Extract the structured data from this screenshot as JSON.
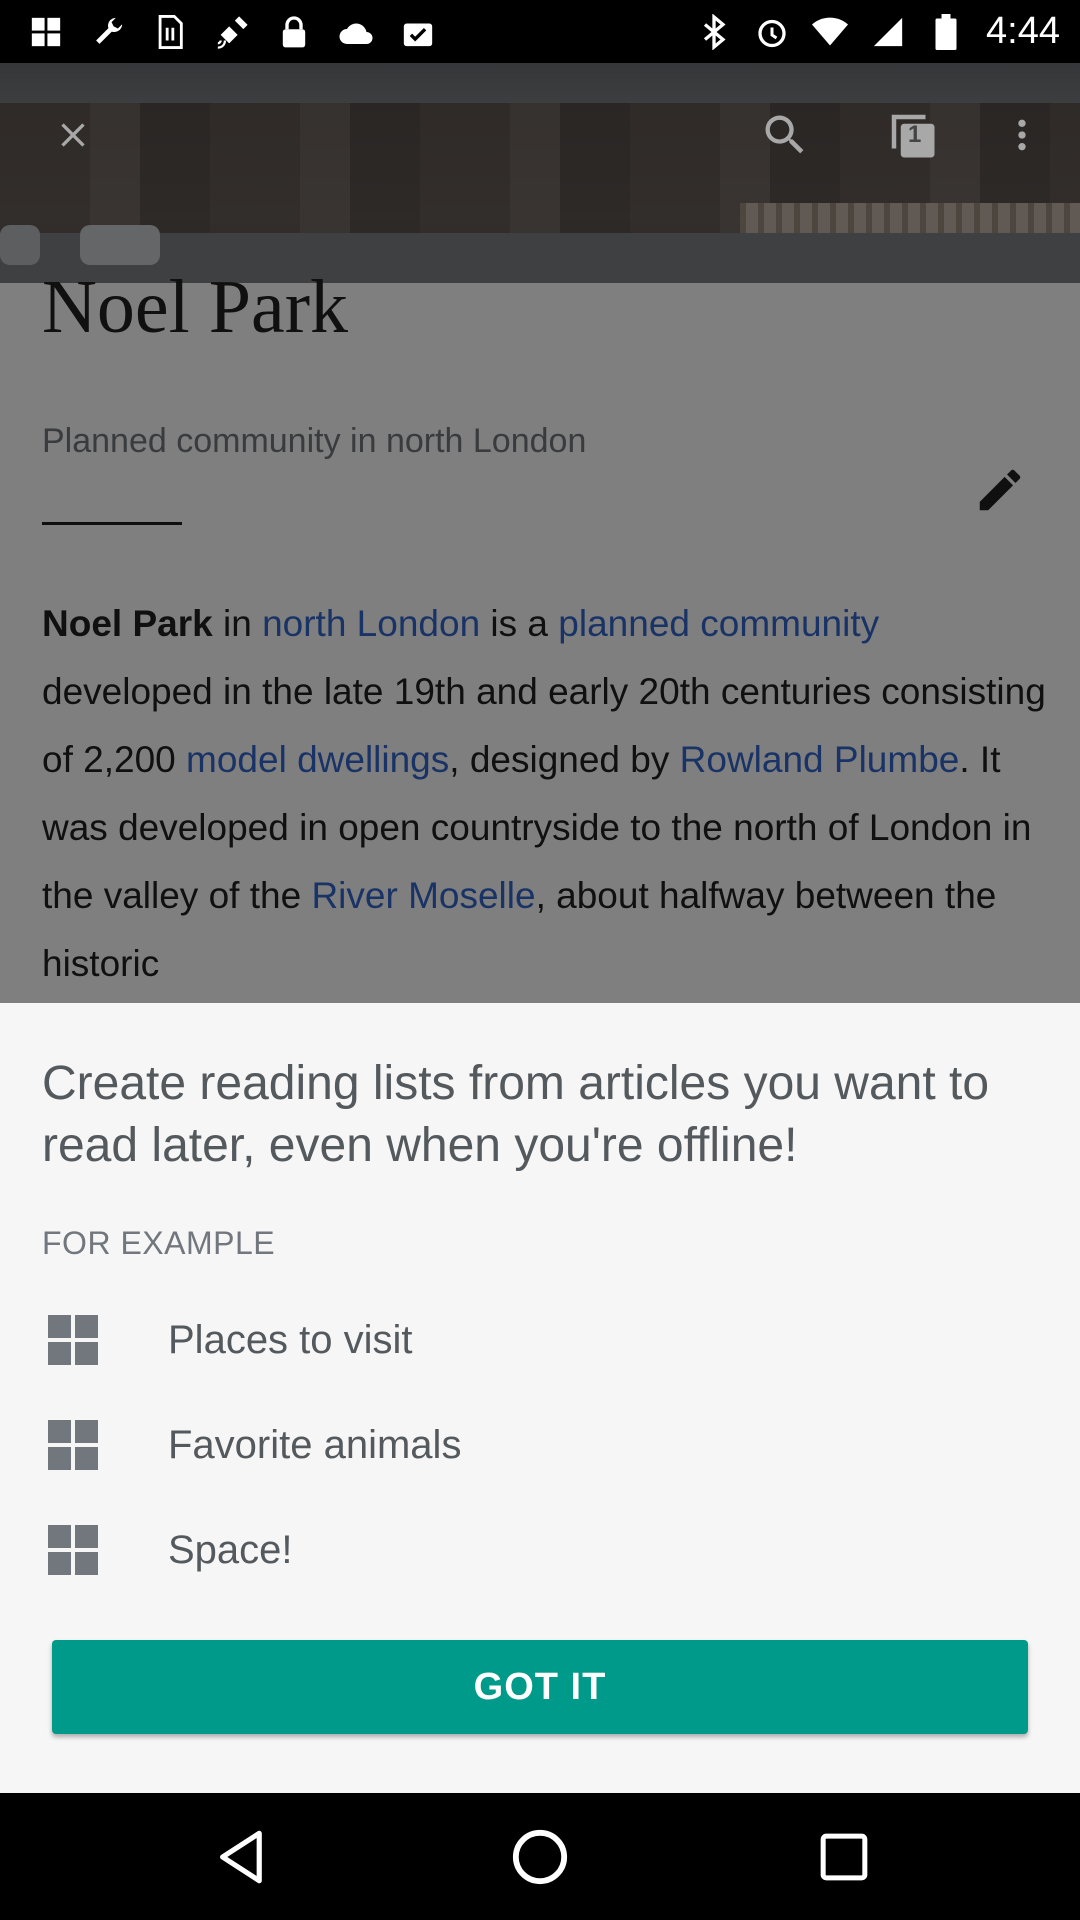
{
  "status_bar": {
    "time": "4:44",
    "left_icons": [
      "grid-icon",
      "wrench-icon",
      "sim-icon",
      "satellite-icon",
      "lock-icon",
      "cloud-icon",
      "checklist-icon"
    ],
    "right_icons": [
      "bluetooth-icon",
      "alarm-icon",
      "wifi-icon",
      "signal-icon",
      "battery-icon"
    ]
  },
  "toolbar": {
    "tabs_count": "1"
  },
  "article": {
    "title": "Noel Park",
    "description": "Planned community in north London",
    "body": {
      "bold": "Noel Park",
      "t1": " in ",
      "l1": "north London",
      "t2": " is a ",
      "l2": "planned community",
      "t3": " developed in the late 19th and early 20th centuries consisting of 2,200 ",
      "l3": "model dwellings",
      "t4": ", designed by ",
      "l4": "Rowland Plumbe",
      "t5": ". It was developed in open countryside to the north of London in the valley of the ",
      "l5": "River Moselle",
      "t6": ", about halfway between the historic"
    },
    "link_color": "#3366cc"
  },
  "sheet": {
    "headline": "Create reading lists from articles you want to read later, even when you're offline!",
    "example_label": "FOR EXAMPLE",
    "items": [
      {
        "label": "Places to visit"
      },
      {
        "label": "Favorite animals"
      },
      {
        "label": "Space!"
      }
    ],
    "button_label": "GOT IT",
    "accent_color": "#009a8a"
  }
}
